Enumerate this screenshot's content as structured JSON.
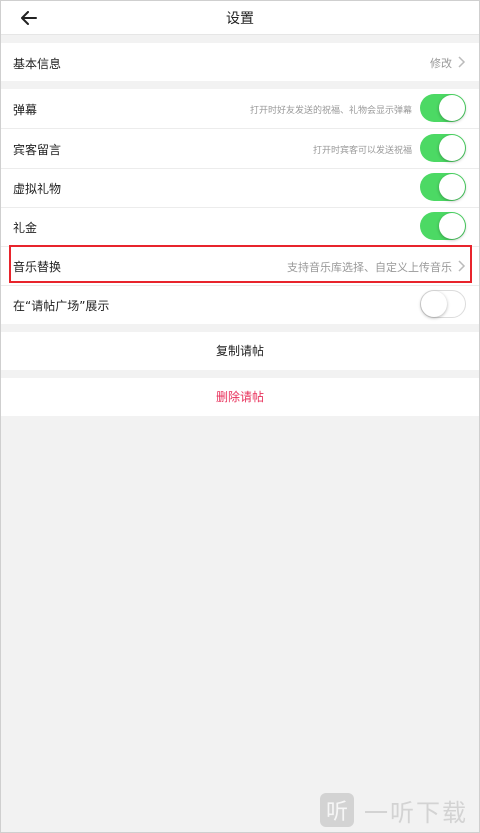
{
  "header": {
    "title": "设置",
    "back_icon": "arrow-left-icon"
  },
  "basic_info": {
    "label": "基本信息",
    "action": "修改"
  },
  "settings": [
    {
      "label": "弹幕",
      "hint": "打开时好友发送的祝福、礼物会显示弹幕",
      "enabled": true
    },
    {
      "label": "宾客留言",
      "hint": "打开时宾客可以发送祝福",
      "enabled": true
    },
    {
      "label": "虚拟礼物",
      "hint": "",
      "enabled": true
    },
    {
      "label": "礼金",
      "hint": "",
      "enabled": true
    }
  ],
  "music": {
    "label": "音乐替换",
    "hint": "支持音乐库选择、自定义上传音乐"
  },
  "square": {
    "label": "在“请帖广场”展示",
    "enabled": false
  },
  "actions": {
    "copy": "复制请帖",
    "delete": "删除请帖"
  },
  "watermark": {
    "logo_char": "听",
    "text": "一听下载"
  },
  "colors": {
    "toggle_on": "#4cd964",
    "delete_text": "#e8315b",
    "highlight_border": "#e8242c",
    "background": "#f2f2f2"
  }
}
